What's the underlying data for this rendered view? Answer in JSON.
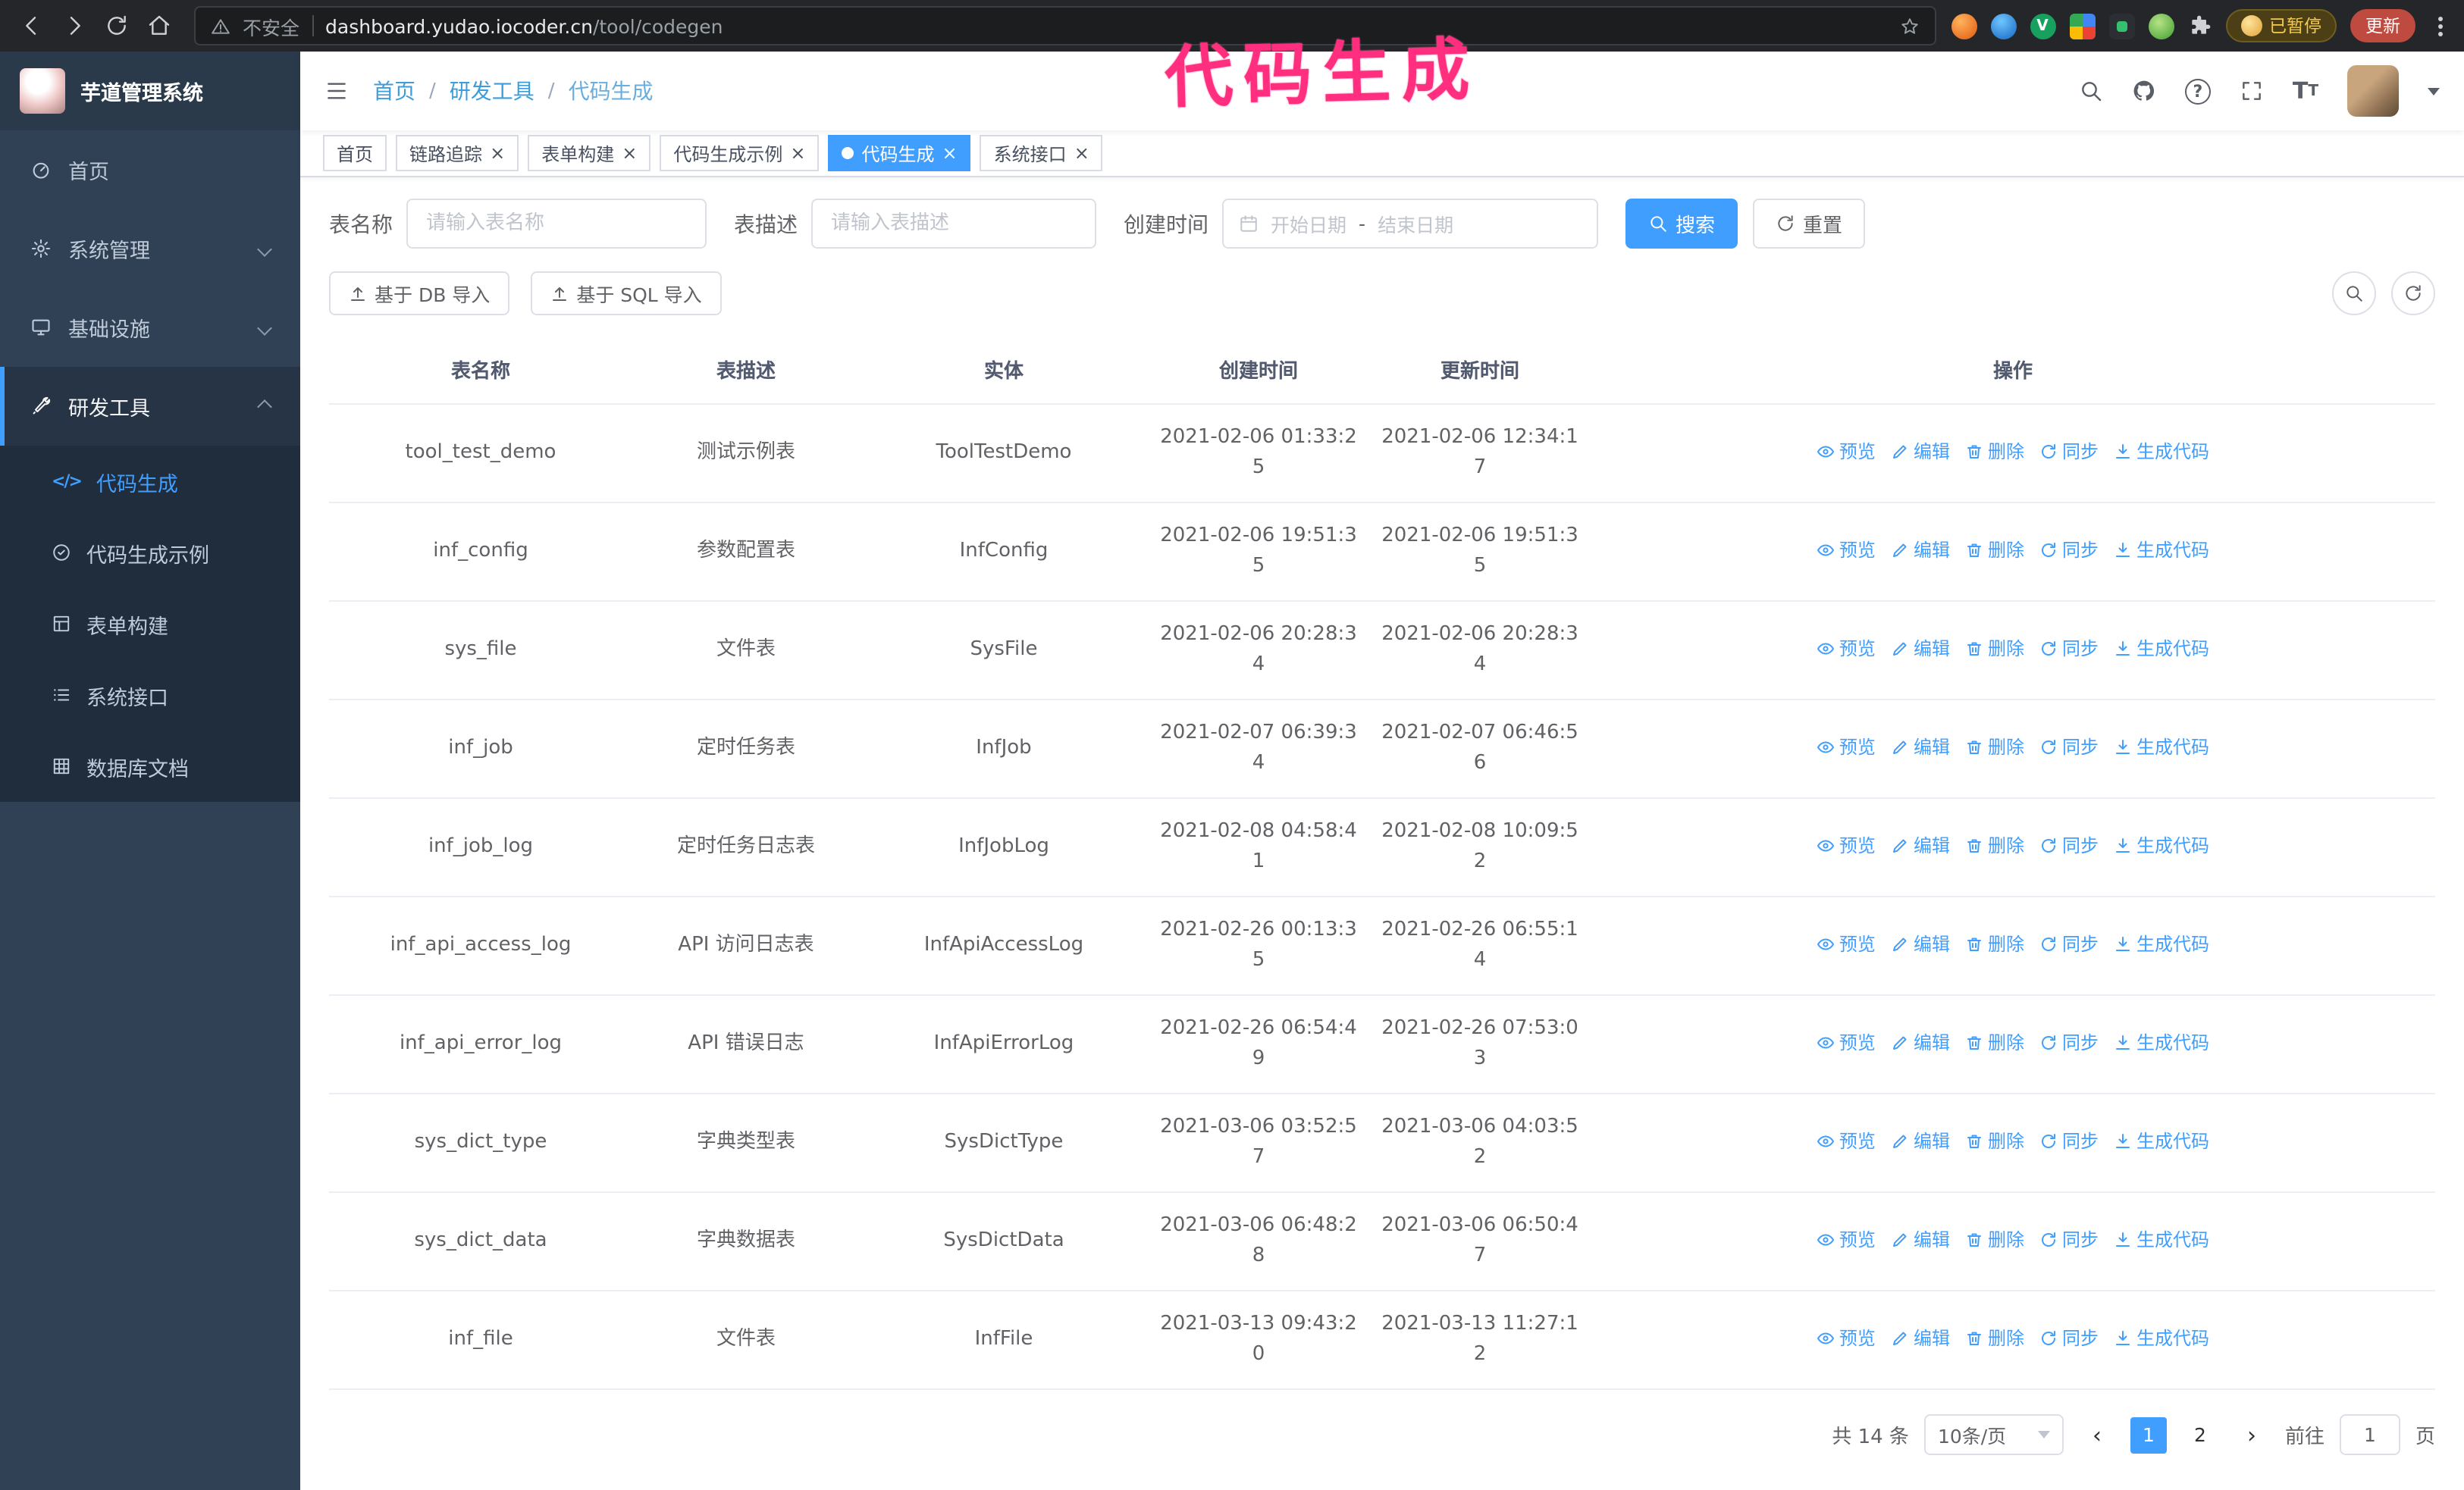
{
  "browser": {
    "security_label": "不安全",
    "url_host": "dashboard.yudao.iocoder.cn",
    "url_path": "/tool/codegen",
    "profile_badge": "已暂停",
    "update_button": "更新"
  },
  "annotation": {
    "text": "代码生成"
  },
  "sidebar": {
    "logo_title": "芋道管理系统",
    "items": [
      {
        "label": "首页"
      },
      {
        "label": "系统管理"
      },
      {
        "label": "基础设施"
      },
      {
        "label": "研发工具"
      }
    ],
    "subitems": [
      {
        "label": "代码生成"
      },
      {
        "label": "代码生成示例"
      },
      {
        "label": "表单构建"
      },
      {
        "label": "系统接口"
      },
      {
        "label": "数据库文档"
      }
    ]
  },
  "breadcrumb": {
    "items": [
      "首页",
      "研发工具",
      "代码生成"
    ],
    "separator": "/"
  },
  "tabs": [
    {
      "label": "首页"
    },
    {
      "label": "链路追踪"
    },
    {
      "label": "表单构建"
    },
    {
      "label": "代码生成示例"
    },
    {
      "label": "代码生成"
    },
    {
      "label": "系统接口"
    }
  ],
  "filters": {
    "table_name_label": "表名称",
    "table_name_placeholder": "请输入表名称",
    "table_desc_label": "表描述",
    "table_desc_placeholder": "请输入表描述",
    "create_time_label": "创建时间",
    "date_start_placeholder": "开始日期",
    "date_separator": "-",
    "date_end_placeholder": "结束日期",
    "search_button": "搜索",
    "reset_button": "重置"
  },
  "toolbar": {
    "import_db": "基于 DB 导入",
    "import_sql": "基于 SQL 导入"
  },
  "table": {
    "headers": [
      "表名称",
      "表描述",
      "实体",
      "创建时间",
      "更新时间",
      "操作"
    ],
    "actions": [
      "预览",
      "编辑",
      "删除",
      "同步",
      "生成代码"
    ],
    "rows": [
      {
        "name": "tool_test_demo",
        "desc": "测试示例表",
        "entity": "ToolTestDemo",
        "created": "2021-02-06 01:33:25",
        "updated": "2021-02-06 12:34:17"
      },
      {
        "name": "inf_config",
        "desc": "参数配置表",
        "entity": "InfConfig",
        "created": "2021-02-06 19:51:35",
        "updated": "2021-02-06 19:51:35"
      },
      {
        "name": "sys_file",
        "desc": "文件表",
        "entity": "SysFile",
        "created": "2021-02-06 20:28:34",
        "updated": "2021-02-06 20:28:34"
      },
      {
        "name": "inf_job",
        "desc": "定时任务表",
        "entity": "InfJob",
        "created": "2021-02-07 06:39:34",
        "updated": "2021-02-07 06:46:56"
      },
      {
        "name": "inf_job_log",
        "desc": "定时任务日志表",
        "entity": "InfJobLog",
        "created": "2021-02-08 04:58:41",
        "updated": "2021-02-08 10:09:52"
      },
      {
        "name": "inf_api_access_log",
        "desc": "API 访问日志表",
        "entity": "InfApiAccessLog",
        "created": "2021-02-26 00:13:35",
        "updated": "2021-02-26 06:55:14"
      },
      {
        "name": "inf_api_error_log",
        "desc": "API 错误日志",
        "entity": "InfApiErrorLog",
        "created": "2021-02-26 06:54:49",
        "updated": "2021-02-26 07:53:03"
      },
      {
        "name": "sys_dict_type",
        "desc": "字典类型表",
        "entity": "SysDictType",
        "created": "2021-03-06 03:52:57",
        "updated": "2021-03-06 04:03:52"
      },
      {
        "name": "sys_dict_data",
        "desc": "字典数据表",
        "entity": "SysDictData",
        "created": "2021-03-06 06:48:28",
        "updated": "2021-03-06 06:50:47"
      },
      {
        "name": "inf_file",
        "desc": "文件表",
        "entity": "InfFile",
        "created": "2021-03-13 09:43:20",
        "updated": "2021-03-13 11:27:12"
      }
    ]
  },
  "pagination": {
    "total": "共 14 条",
    "page_size": "10条/页",
    "page_1": "1",
    "page_2": "2",
    "goto_label": "前往",
    "goto_value": "1",
    "unit_label": "页"
  },
  "colors": {
    "accent": "#409eff",
    "annotation": "#ff2e7e",
    "sidebar": "#304156"
  }
}
